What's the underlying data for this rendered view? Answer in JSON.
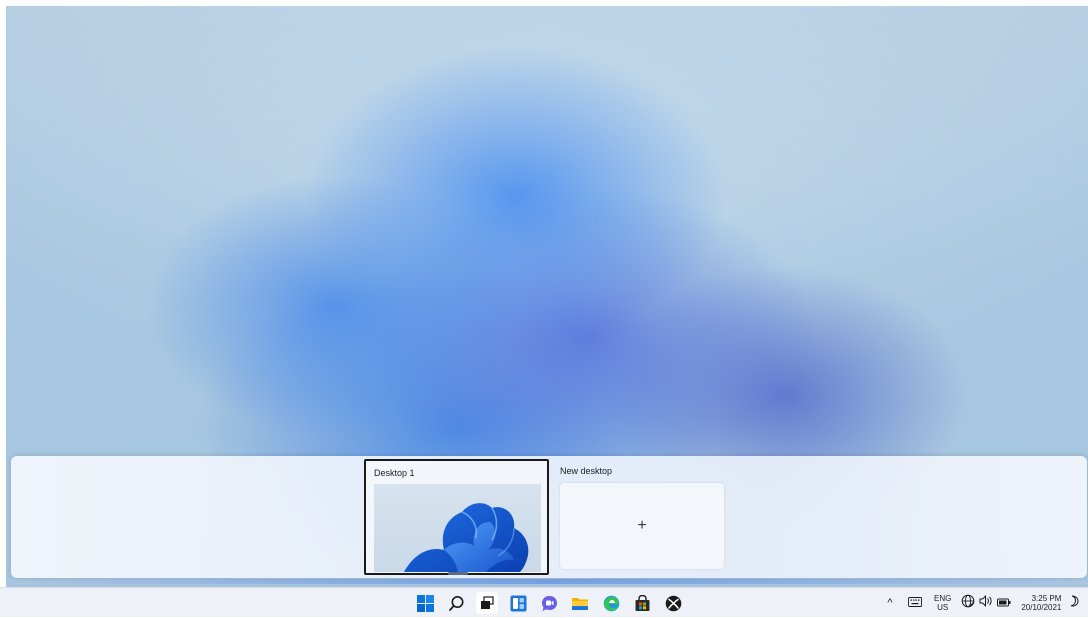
{
  "wallpaper": {
    "style": "Windows 11 Bloom (blurred)"
  },
  "task_view": {
    "desktops": [
      {
        "label": "Desktop 1",
        "active": true
      },
      {
        "label": "New desktop",
        "action": "+"
      }
    ]
  },
  "taskbar": {
    "icons": [
      {
        "name": "start-icon",
        "active": false
      },
      {
        "name": "search-icon",
        "active": false
      },
      {
        "name": "task-view-icon",
        "active": true
      },
      {
        "name": "widgets-icon",
        "active": false
      },
      {
        "name": "chat-icon",
        "active": false
      },
      {
        "name": "file-explorer-icon",
        "active": false
      },
      {
        "name": "edge-icon",
        "active": false
      },
      {
        "name": "store-icon",
        "active": false
      },
      {
        "name": "xbox-icon",
        "active": false
      }
    ],
    "tray": {
      "chevron": "^",
      "lang_top": "ENG",
      "lang_bottom": "US",
      "time": "3:25 PM",
      "date": "20/10/2021"
    }
  },
  "colors": {
    "accent": "#0078d4",
    "taskbar_bg": "#eef2f8"
  }
}
